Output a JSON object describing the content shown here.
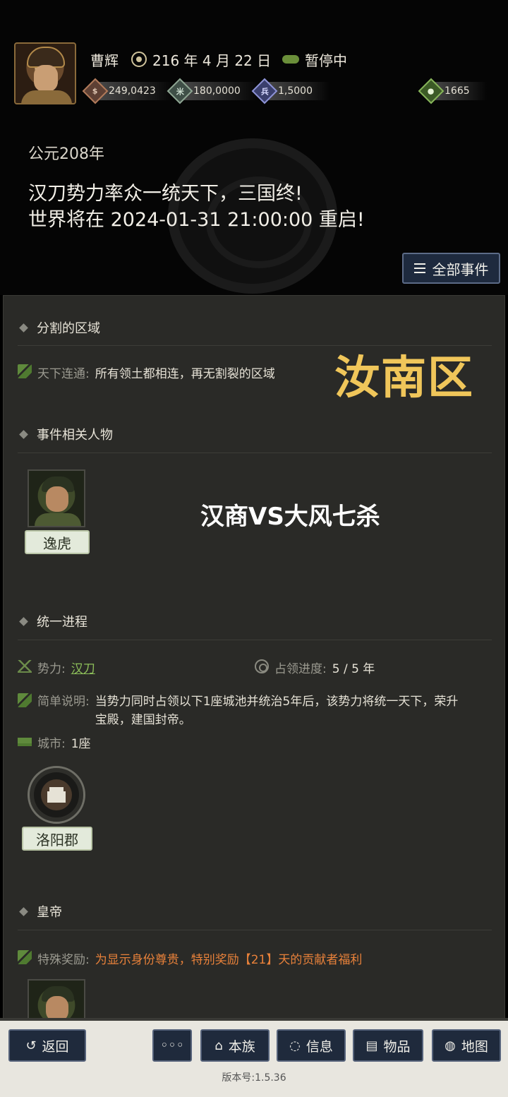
{
  "header": {
    "player_name": "曹辉",
    "date": "216 年 4 月 22 日",
    "state": "暂停中",
    "resources": {
      "gold": "249,0423",
      "food": "180,0000",
      "troops": "1,5000",
      "gems": "1665"
    }
  },
  "event": {
    "era": "公元208年",
    "headline_line1": "汉刀势力率众一统天下，三国终!",
    "headline_line2": "世界将在 2024-01-31 21:00:00 重启!",
    "all_events_label": "全部事件"
  },
  "sections": {
    "split_regions": {
      "title": "分割的区域",
      "label": "天下连通:",
      "value": "所有领土都相连，再无割裂的区域"
    },
    "related_people": {
      "title": "事件相关人物",
      "person_name": "逸虎"
    },
    "progress": {
      "title": "统一进程",
      "force_label": "势力:",
      "force_value": "汉刀",
      "occupy_label": "占领进度:",
      "occupy_value": "5 / 5 年",
      "desc_label": "简单说明:",
      "desc_value": "当势力同时占领以下1座城池并统治5年后，该势力将统一天下，荣升宝殿，建国封帝。",
      "city_label": "城市:",
      "city_value": "1座",
      "city_name": "洛阳郡"
    },
    "emperor": {
      "title": "皇帝",
      "reward_label": "特殊奖励:",
      "reward_value": "为显示身份尊贵，特别奖励【21】天的贡献者福利"
    }
  },
  "overlay": {
    "server_name": "汝南区",
    "match_text": "汉商VS大风七杀"
  },
  "bottom": {
    "back": "返回",
    "more": "◦◦◦",
    "clan": "本族",
    "info": "信息",
    "items": "物品",
    "map": "地图",
    "version": "版本号:1.5.36"
  }
}
